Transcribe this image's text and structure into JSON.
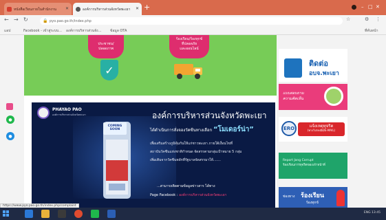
{
  "browser": {
    "tabs": [
      {
        "label": "หนังสือเวียนภายในสำนักงาน",
        "active": false,
        "favicon_color": "#d63b2d"
      },
      {
        "label": "องค์การบริหารส่วนจังหวัดพะเยา",
        "active": true,
        "favicon_color": "#555555"
      }
    ],
    "url": "pyo.pao.go.th/index.php",
    "bookmarks": [
      "แอป",
      "Facebook - เข้าสู่ระบบ...",
      "องค์การบริหารส่วนจัง...",
      "ข้อมูล OTA"
    ],
    "bookmarks_right": "ที่คั่นหน้า"
  },
  "page": {
    "hero_buttons": [
      {
        "line1": "ประชาชน/",
        "line2": "ปลอดภาพ"
      },
      {
        "line1": "ร้องเรียน/ร้องทุกข์",
        "line2": "ที่ปลอดภัย",
        "line3": "และออนไลน์"
      }
    ],
    "banner": {
      "logo_title": "PHAYAO PAO",
      "logo_sub": "องค์การบริหารส่วนจังหวัดพะเยา",
      "coming_soon": "COMING SOON",
      "title": "องค์การบริหารส่วนจังหวัดพะเยา",
      "line1_prefix": "ได้ดำเนินการสั่งจองวัคซีนทางเลือก",
      "line1_quote": "“โมเดอร์น่า”",
      "line2": "เพื่อเสริมสร้างภูมิคุ้มกันให้แก่ชาวพะเยา ภายใต้เงื่อนไขที่",
      "line3": "สถาบันวัคซีนแห่งชาติกำหนด จัดสรรตามกลุ่มเป้าหมาย 5 กลุ่ม",
      "line4": "เพิ่มเติมจากวัคซีนหลักที่รัฐบาลจัดสรรมาให้.......",
      "follow": "...สามารถติดตามข้อมูลข่าวสาร ได้ทาง",
      "fb_prefix": "Page Facebook :",
      "fb_name": "องค์การบริหารส่วนจังหวัดพะเยา"
    },
    "right": {
      "contact_title": "ติดต่อ",
      "contact_sub": "อบจ.พะเยา",
      "survey_line1": "แบบสอบถาม",
      "survey_line2": "ความคิดเห็น",
      "report_logo": "ERO",
      "report_line1": "แจ้งเหตุทุจริต",
      "report_line2": "(ทางไปรษณีย์/E-MAIL)",
      "anticorrupt_line1": "Report Jang Corrupt",
      "anticorrupt_line2": "ร้องเรียนการทุจริตของเจ้าหน้าที่",
      "complaint_small": "ช่องทาง",
      "complaint_big": "ร้องเรียน",
      "complaint_sub": "ร้องทุกข์"
    },
    "status_url": "https://www.pyo.pao.go.th/index.php/complaint"
  },
  "taskbar": {
    "tray_text": "ENG  13:45"
  },
  "colors": {
    "tabbar": "#d96a4c",
    "hero_green": "#77cc57",
    "pink": "#de2d6e",
    "banner_navy": "#0a1a44"
  }
}
